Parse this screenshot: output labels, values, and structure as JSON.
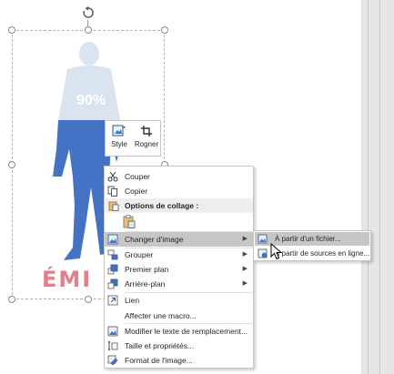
{
  "slide": {
    "percent_label": "90%",
    "wordart_text": "ÉMI"
  },
  "mini_toolbar": {
    "style_label": "Style",
    "crop_label": "Rogner"
  },
  "context_menu": {
    "items": [
      {
        "label": "Couper",
        "icon": "scissors-icon"
      },
      {
        "label": "Copier",
        "icon": "copy-icon"
      },
      {
        "label": "Options de collage :",
        "icon": "paste-icon"
      },
      {
        "label": "",
        "icon": "paste-keep-icon"
      },
      {
        "label": "Changer d'image",
        "icon": "change-picture-icon",
        "submenu": true
      },
      {
        "label": "Grouper",
        "icon": "group-icon",
        "submenu": true
      },
      {
        "label": "Premier plan",
        "icon": "bring-front-icon",
        "submenu": true
      },
      {
        "label": "Arrière-plan",
        "icon": "send-back-icon",
        "submenu": true
      },
      {
        "label": "Lien",
        "icon": "link-icon"
      },
      {
        "label": "Affecter une macro...",
        "icon": ""
      },
      {
        "label": "Modifier le texte de remplacement...",
        "icon": "alt-text-icon"
      },
      {
        "label": "Taille et propriétés...",
        "icon": "size-icon"
      },
      {
        "label": "Format de l'image...",
        "icon": "format-picture-icon"
      }
    ]
  },
  "submenu": {
    "items": [
      {
        "label": "À partir d'un fichier...",
        "icon": "from-file-icon"
      },
      {
        "label": "À partir de sources en ligne...",
        "icon": "from-online-icon"
      }
    ]
  },
  "colors": {
    "figure_blue": "#4472c4",
    "figure_light": "#dae3f0",
    "wordart_pink": "#e0808a",
    "menu_highlight": "#c6c6c6"
  }
}
